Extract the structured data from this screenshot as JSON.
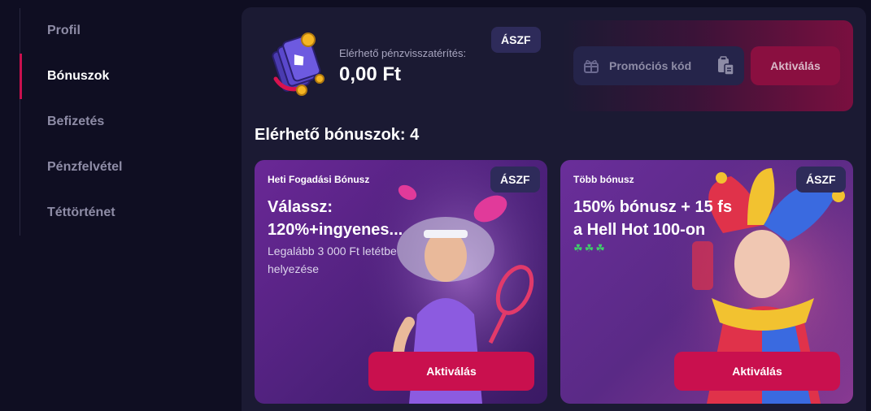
{
  "sidebar": {
    "items": [
      {
        "label": "Profil"
      },
      {
        "label": "Bónuszok",
        "active": true
      },
      {
        "label": "Befizetés"
      },
      {
        "label": "Pénzfelvétel"
      },
      {
        "label": "Téttörténet"
      }
    ]
  },
  "cashback": {
    "label": "Elérhető pénzvisszatérítés:",
    "amount": "0,00 Ft",
    "terms_label": "ÁSZF"
  },
  "promo": {
    "placeholder": "Promóciós kód",
    "activate_label": "Aktiválás"
  },
  "bonuses": {
    "title": "Elérhető bónuszok: 4",
    "cards": [
      {
        "tag": "Heti Fogadási Bónusz",
        "title": "Válassz: 120%+ingyenes...",
        "description": "Legalább 3 000 Ft letétbe helyezése",
        "terms_label": "ÁSZF",
        "activate_label": "Aktiválás"
      },
      {
        "tag": "Több bónusz",
        "title": "150% bónusz + 15 fs a Hell Hot 100-on",
        "clovers": "☘☘☘",
        "terms_label": "ÁSZF",
        "activate_label": "Aktiválás"
      }
    ]
  },
  "colors": {
    "accent": "#c9104e",
    "background": "#0f0e22",
    "panel": "#1b1a33",
    "badge": "#2e2b5a"
  }
}
